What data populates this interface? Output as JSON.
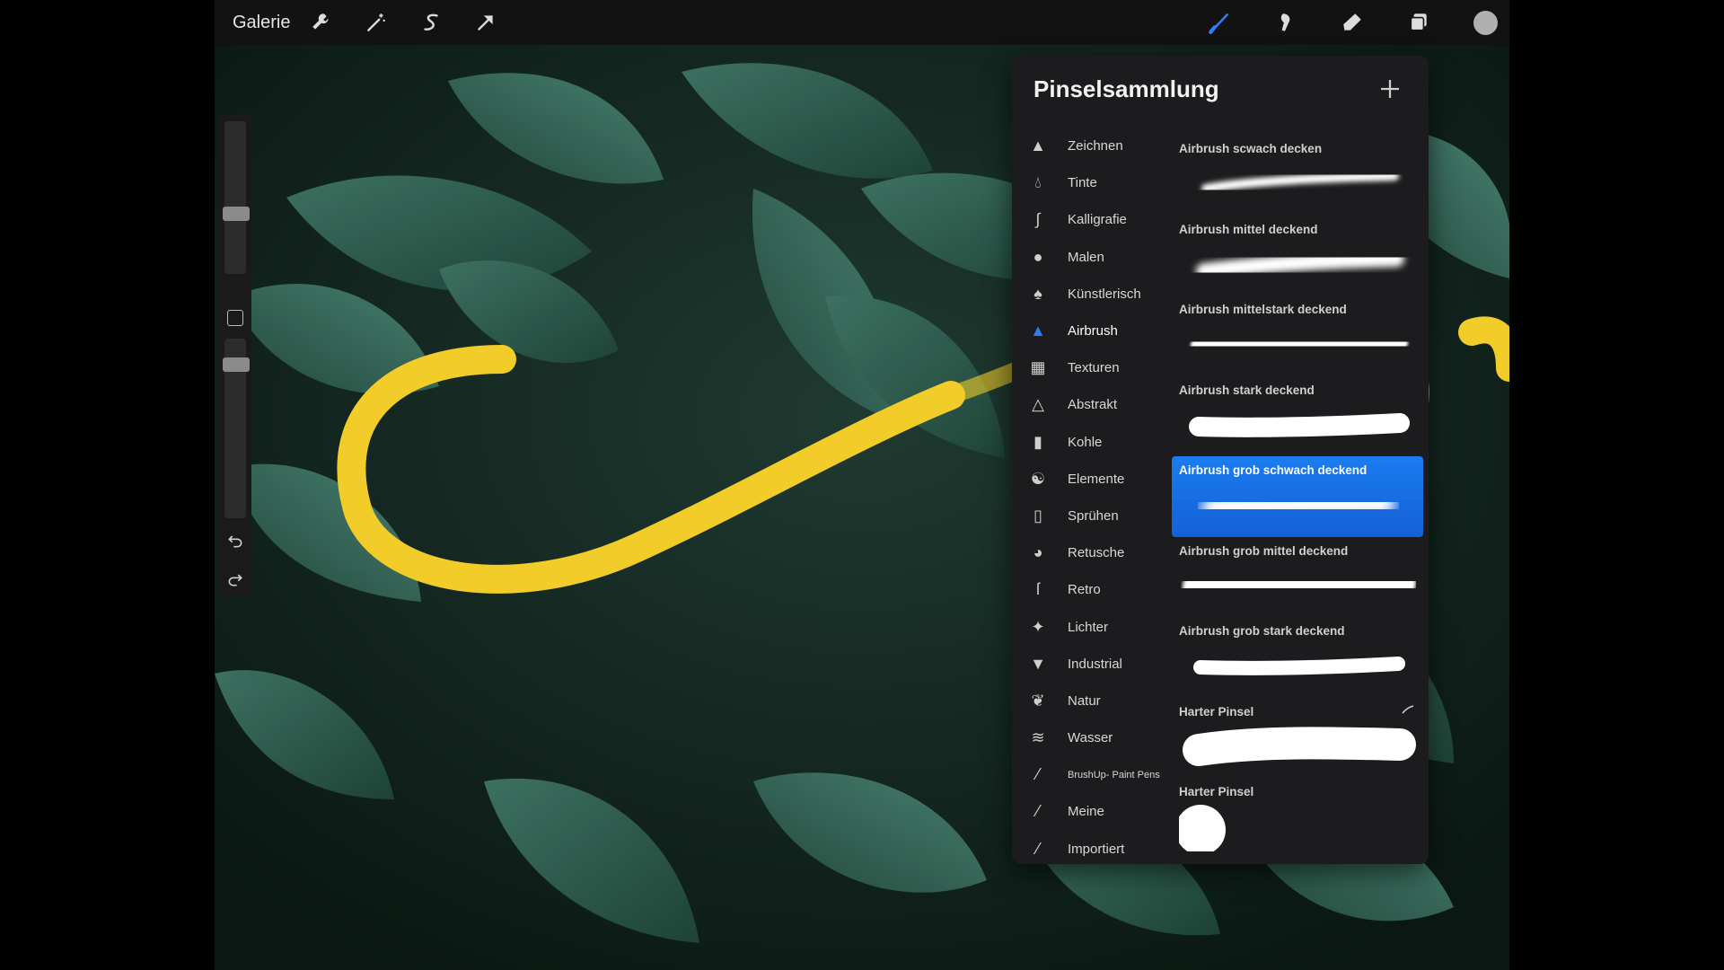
{
  "topbar": {
    "gallery_label": "Galerie",
    "left_tools": [
      "wrench-icon",
      "magic-wand-icon",
      "selection-icon",
      "transform-arrow-icon"
    ],
    "right_tools": [
      "brush-icon",
      "smudge-icon",
      "eraser-icon",
      "layers-icon",
      "color-swatch"
    ],
    "active_tool_color": "#2f7cf6",
    "current_color": "#b0b0b0"
  },
  "panel": {
    "title": "Pinselsammlung",
    "add_label": "+",
    "categories": [
      {
        "label": "Zeichnen",
        "icon": "pencil-icon"
      },
      {
        "label": "Tinte",
        "icon": "ink-drop-icon"
      },
      {
        "label": "Kalligrafie",
        "icon": "calligraphy-icon"
      },
      {
        "label": "Malen",
        "icon": "paint-drop-icon"
      },
      {
        "label": "Künstlerisch",
        "icon": "artistic-icon"
      },
      {
        "label": "Airbrush",
        "icon": "airbrush-icon",
        "active": true
      },
      {
        "label": "Texturen",
        "icon": "texture-icon"
      },
      {
        "label": "Abstrakt",
        "icon": "triangle-icon"
      },
      {
        "label": "Kohle",
        "icon": "charcoal-icon"
      },
      {
        "label": "Elemente",
        "icon": "yin-yang-icon"
      },
      {
        "label": "Sprühen",
        "icon": "spray-can-icon"
      },
      {
        "label": "Retusche",
        "icon": "retouch-icon"
      },
      {
        "label": "Retro",
        "icon": "retro-icon"
      },
      {
        "label": "Lichter",
        "icon": "sparkle-icon"
      },
      {
        "label": "Industrial",
        "icon": "anvil-icon"
      },
      {
        "label": "Natur",
        "icon": "leaf-icon"
      },
      {
        "label": "Wasser",
        "icon": "waves-icon"
      },
      {
        "label": "BrushUp- Paint Pens",
        "icon": "custom-brush-icon"
      },
      {
        "label": "Meine",
        "icon": "custom-brush-icon"
      },
      {
        "label": "Importiert",
        "icon": "custom-brush-icon"
      }
    ],
    "brushes": [
      {
        "name": "Airbrush scwach decken",
        "style": "soft-thin"
      },
      {
        "name": "Airbrush mittel deckend",
        "style": "soft-medium"
      },
      {
        "name": "Airbrush mittelstark deckend",
        "style": "medium"
      },
      {
        "name": "Airbrush stark deckend",
        "style": "hard"
      },
      {
        "name": "Airbrush grob schwach deckend",
        "style": "soft-wide",
        "active": true
      },
      {
        "name": "Airbrush grob mittel deckend",
        "style": "medium-wide"
      },
      {
        "name": "Airbrush grob stark deckend",
        "style": "hard-thin"
      },
      {
        "name": "Harter Pinsel",
        "style": "hard-wide",
        "edited": true
      },
      {
        "name": "Harter Pinsel",
        "style": "dot"
      }
    ]
  },
  "colors": {
    "stroke_yellow": "#f2cd2a",
    "selection_blue": "#1a7cf0",
    "panel_bg": "#1c1c1e"
  }
}
